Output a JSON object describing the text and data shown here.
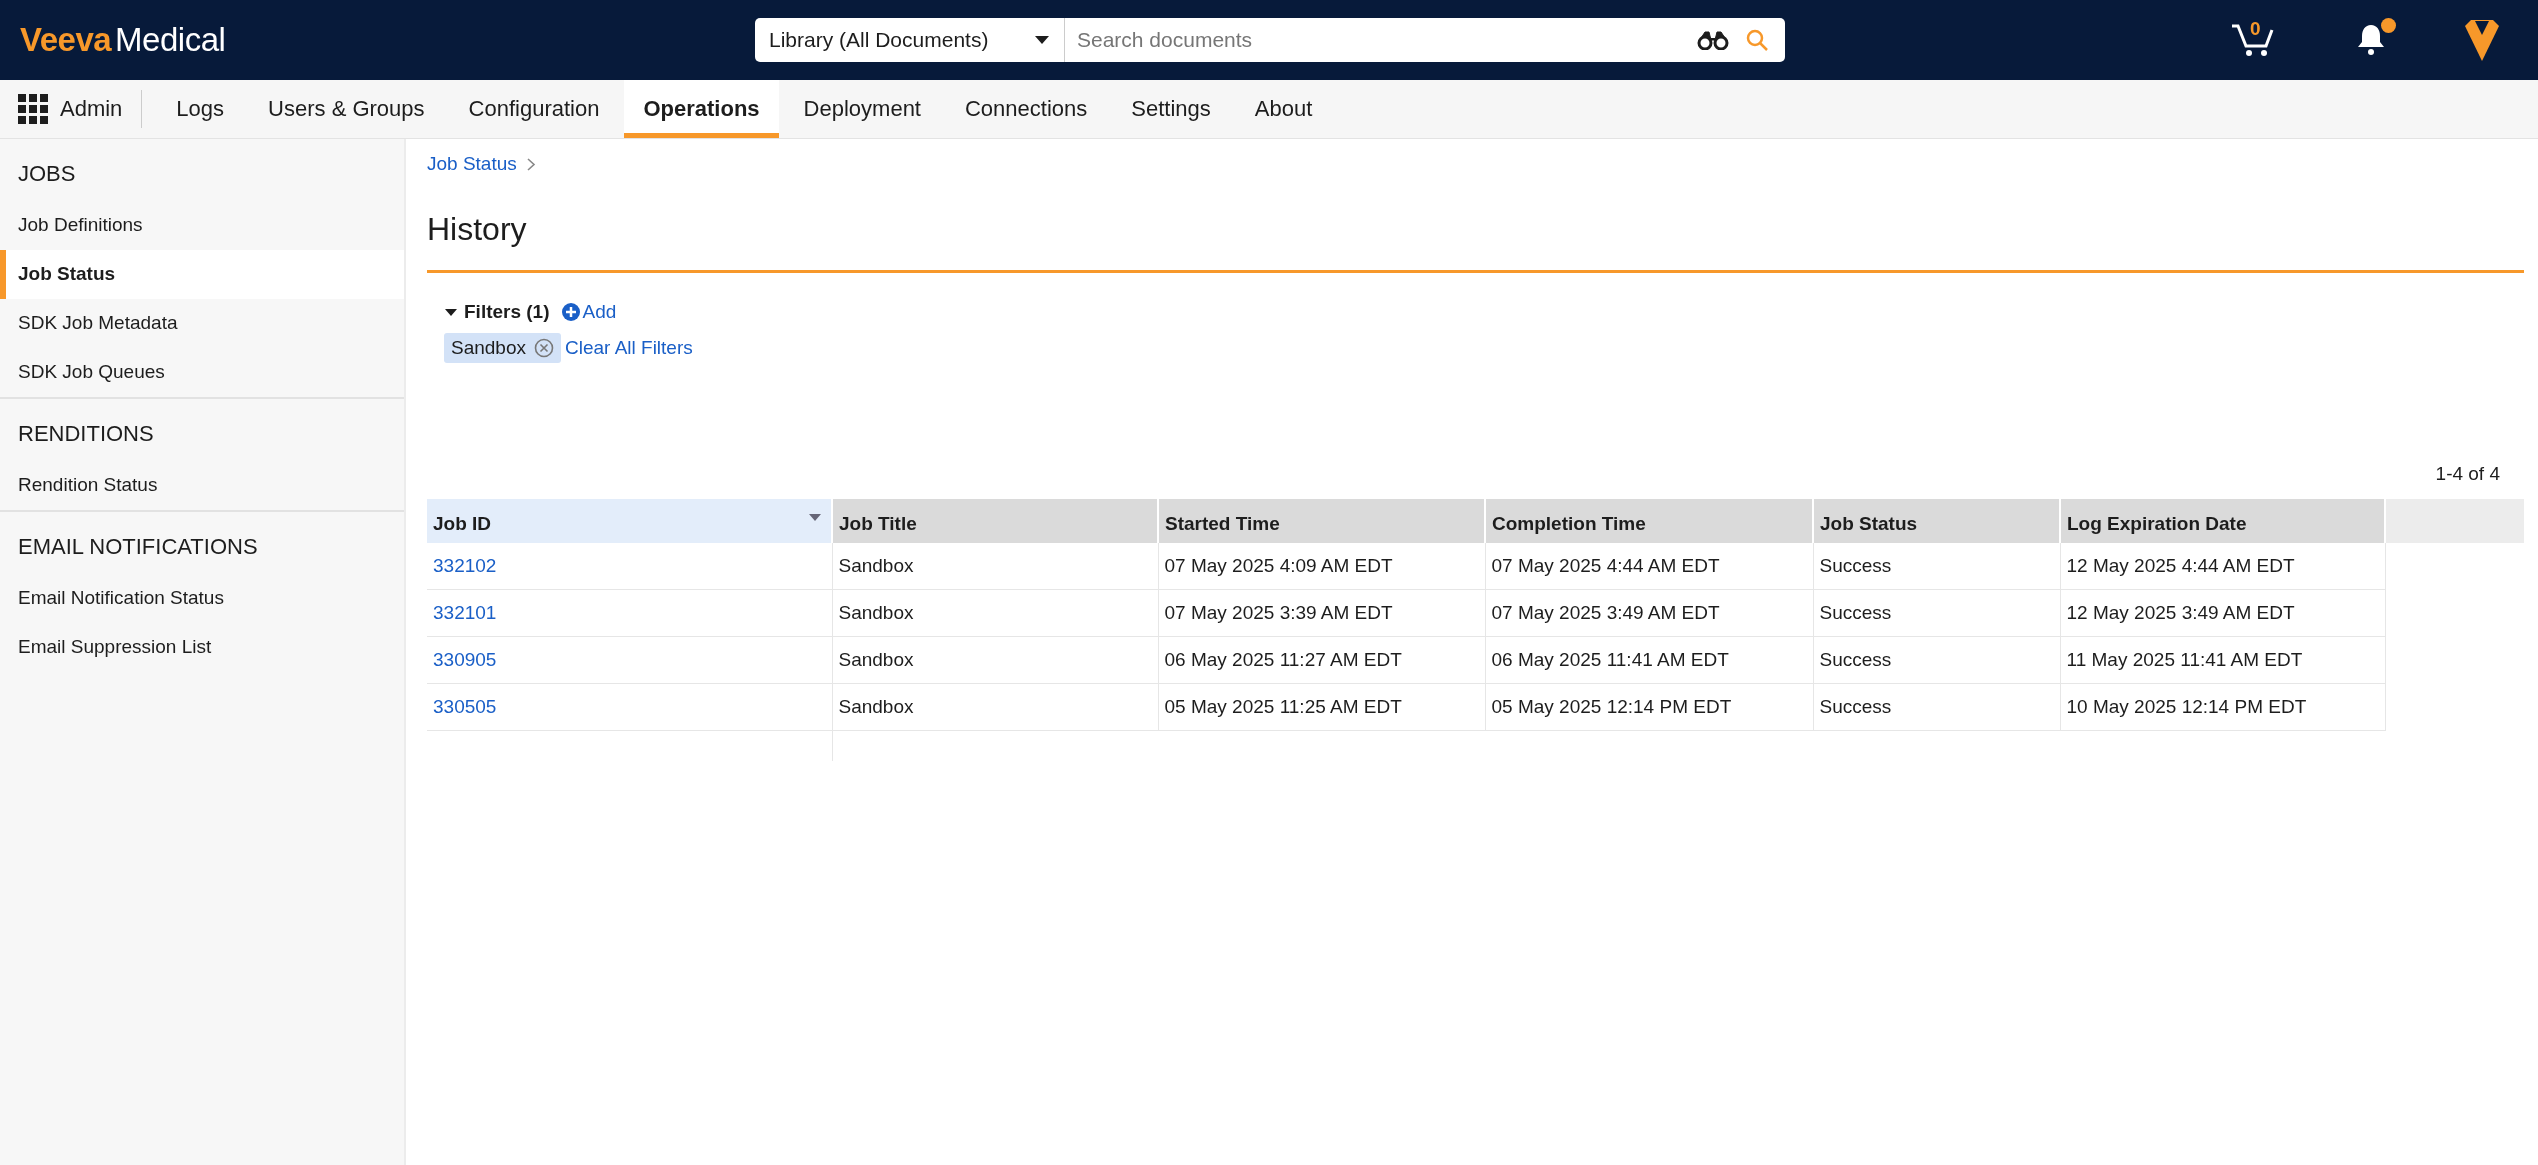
{
  "header": {
    "logo": {
      "brand": "Veeva",
      "product": "Medical"
    },
    "search": {
      "scope": "Library (All Documents)",
      "placeholder": "Search documents"
    },
    "cart_count": "0",
    "notifications_unread": true
  },
  "nav": {
    "app": "Admin",
    "tabs": [
      {
        "label": "Logs",
        "selected": false
      },
      {
        "label": "Users & Groups",
        "selected": false
      },
      {
        "label": "Configuration",
        "selected": false
      },
      {
        "label": "Operations",
        "selected": true
      },
      {
        "label": "Deployment",
        "selected": false
      },
      {
        "label": "Connections",
        "selected": false
      },
      {
        "label": "Settings",
        "selected": false
      },
      {
        "label": "About",
        "selected": false
      }
    ]
  },
  "sidebar": {
    "sections": [
      {
        "title": "JOBS",
        "items": [
          {
            "label": "Job Definitions",
            "selected": false
          },
          {
            "label": "Job Status",
            "selected": true
          },
          {
            "label": "SDK Job Metadata",
            "selected": false
          },
          {
            "label": "SDK Job Queues",
            "selected": false
          }
        ]
      },
      {
        "title": "RENDITIONS",
        "items": [
          {
            "label": "Rendition Status",
            "selected": false
          }
        ]
      },
      {
        "title": "EMAIL NOTIFICATIONS",
        "items": [
          {
            "label": "Email Notification Status",
            "selected": false
          },
          {
            "label": "Email Suppression List",
            "selected": false
          }
        ]
      }
    ]
  },
  "breadcrumb": [
    {
      "label": "Job Status"
    }
  ],
  "page_title": "History",
  "filters": {
    "label": "Filters (1)",
    "expanded": true,
    "add": "Add",
    "chips": [
      "Sandbox"
    ],
    "clear": "Clear All Filters"
  },
  "pagination": "1-4 of 4",
  "table": {
    "columns": [
      {
        "label": "Job ID",
        "sorted": true
      },
      {
        "label": "Job Title",
        "sorted": false
      },
      {
        "label": "Started Time",
        "sorted": false
      },
      {
        "label": "Completion Time",
        "sorted": false
      },
      {
        "label": "Job Status",
        "sorted": false
      },
      {
        "label": "Log Expiration Date",
        "sorted": false
      }
    ],
    "rows": [
      [
        "332102",
        "Sandbox",
        "07 May 2025 4:09 AM EDT",
        "07 May 2025 4:44 AM EDT",
        "Success",
        "12 May 2025 4:44 AM EDT"
      ],
      [
        "332101",
        "Sandbox",
        "07 May 2025 3:39 AM EDT",
        "07 May 2025 3:49 AM EDT",
        "Success",
        "12 May 2025 3:49 AM EDT"
      ],
      [
        "330905",
        "Sandbox",
        "06 May 2025 11:27 AM EDT",
        "06 May 2025 11:41 AM EDT",
        "Success",
        "11 May 2025 11:41 AM EDT"
      ],
      [
        "330505",
        "Sandbox",
        "05 May 2025 11:25 AM EDT",
        "05 May 2025 12:14 PM EDT",
        "Success",
        "10 May 2025 12:14 PM EDT"
      ]
    ]
  }
}
